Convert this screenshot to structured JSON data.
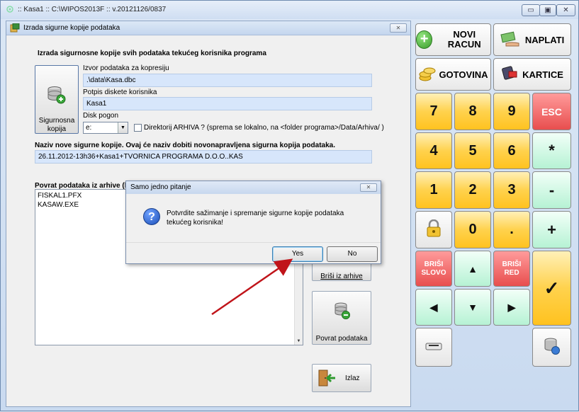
{
  "window": {
    "title": ":: Kasa1 :: C:\\WIPOS2013F :: v.20121126/0837",
    "min_glyph": "▭",
    "max_glyph": "▣",
    "close_glyph": "✕"
  },
  "dialog": {
    "title": "Izrada sigurne kopije podataka",
    "close_glyph": "✕",
    "heading": "Izrada sigurnosne kopije svih podataka tekućeg korisnika programa",
    "backup_button": "Sigurnosna kopija",
    "source_label": "Izvor podataka za kopresiju",
    "source_value": ".\\data\\Kasa.dbc",
    "signature_label": "Potpis diskete korisnika",
    "signature_value": "Kasa1",
    "drive_label": "Disk pogon",
    "drive_value": "e:",
    "archive_checkbox_label": "Direktorij ARHIVA ? (sprema se lokalno, na <folder programa>/Data/Arhiva/ )",
    "new_copy_label": "Naziv nove sigurne kopije. Ovaj će naziv dobiti novonapravljena sigurna kopija podataka.",
    "new_copy_value": "26.11.2012-13h36+Kasa1+TVORNICA PROGRAMA D.O.O..KAS",
    "restore_list_label": "Povrat podataka iz arhive (lis",
    "restore_list_items": [
      "FISKAL1.PFX",
      "KASAW.EXE"
    ],
    "delete_button": "Briši iz arhive",
    "restore_button": "Povrat podataka",
    "exit_button": "Izlaz"
  },
  "modal": {
    "title": "Samo jedno pitanje",
    "close_glyph": "✕",
    "icon_glyph": "?",
    "message": "Potvrdite sažimanje i spremanje sigurne kopije podataka tekućeg korisnika!",
    "yes": "Yes",
    "no": "No"
  },
  "keypad": {
    "new_bill": "NOVI RACUN",
    "pay": "NAPLATI",
    "cash": "GOTOVINA",
    "cards": "KARTICE",
    "plus_glyph": "+",
    "keys": {
      "k7": "7",
      "k8": "8",
      "k9": "9",
      "esc": "ESC",
      "k4": "4",
      "k5": "5",
      "k6": "6",
      "multiply": "*",
      "k1": "1",
      "k2": "2",
      "k3": "3",
      "minus": "-",
      "k0": "0",
      "dot": ".",
      "plus": "+",
      "delete_char": "BRIŠI SLOVO",
      "delete_row": "BRIŠI RED",
      "confirm": "✓",
      "up": "▲",
      "down": "▼",
      "left": "◀",
      "right": "▶"
    }
  }
}
